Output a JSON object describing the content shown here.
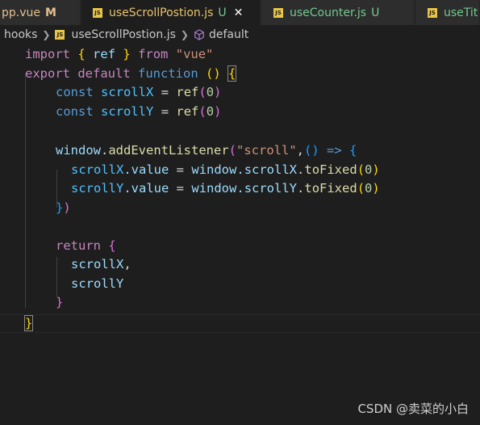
{
  "tabs": [
    {
      "label": "pp.vue",
      "status": "M"
    },
    {
      "label": "useScrollPostion.js",
      "status": "U",
      "active": true
    },
    {
      "label": "useCounter.js",
      "status": "U"
    },
    {
      "label": "useTit",
      "status": ""
    }
  ],
  "tab_icon_text": "JS",
  "breadcrumbs": {
    "folder": "hooks",
    "file": "useScrollPostion.js",
    "symbol": "default"
  },
  "code": {
    "l1": {
      "import": "import",
      "b1": "{",
      "ref": "ref",
      "b2": "}",
      "from": "from",
      "str": "\"vue\""
    },
    "l2": {
      "export": "export",
      "default": "default",
      "function": "function",
      "paren": "()",
      "brace": "{"
    },
    "l3": {
      "const": "const",
      "name": "scrollX",
      "eq": "=",
      "fn": "ref",
      "open": "(",
      "num": "0",
      "close": ")"
    },
    "l4": {
      "const": "const",
      "name": "scrollY",
      "eq": "=",
      "fn": "ref",
      "open": "(",
      "num": "0",
      "close": ")"
    },
    "l6": {
      "obj": "window",
      "dot": ".",
      "fn": "addEventListener",
      "open": "(",
      "str": "\"scroll\"",
      "comma": ",",
      "arrow_parens": "()",
      "arrow": "=>",
      "brace": "{"
    },
    "l7": {
      "name": "scrollX",
      "prop": ".value",
      "eq": "=",
      "obj": "window",
      "member": ".scrollX",
      "dot": ".",
      "fn": "toFixed",
      "open": "(",
      "num": "0",
      "close": ")"
    },
    "l8": {
      "name": "scrollY",
      "prop": ".value",
      "eq": "=",
      "obj": "window",
      "member": ".scrollY",
      "dot": ".",
      "fn": "toFixed",
      "open": "(",
      "num": "0",
      "close": ")"
    },
    "l9": {
      "brace": "}",
      "paren": ")"
    },
    "l11": {
      "return": "return",
      "brace": "{"
    },
    "l12": {
      "name": "scrollX",
      "comma": ","
    },
    "l13": {
      "name": "scrollY"
    },
    "l14": {
      "brace": "}"
    },
    "l15": {
      "brace": "}"
    }
  },
  "watermark": "CSDN @卖菜的小白",
  "colors": {
    "background": "#1e1e1e",
    "tab_inactive": "#2d2d2d",
    "keyword": "#c586c0",
    "storage": "#569cd6",
    "variable": "#9cdcfe",
    "constant": "#4fc1ff",
    "function": "#dcdcaa",
    "string": "#ce9178",
    "number": "#b5cea8"
  }
}
